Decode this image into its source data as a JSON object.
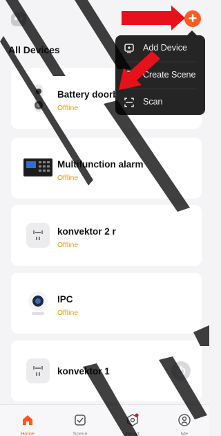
{
  "header": {
    "title": "All Devices",
    "add_label": "+"
  },
  "menu": {
    "items": [
      {
        "label": "Add Device",
        "icon": "add-device-icon"
      },
      {
        "label": "Create Scene",
        "icon": "create-scene-icon"
      },
      {
        "label": "Scan",
        "icon": "scan-icon"
      }
    ]
  },
  "devices": [
    {
      "name": "Battery doorbell",
      "status": "Offline",
      "icon": "doorbell-icon"
    },
    {
      "name": "Multifunction alarm",
      "status": "Offline",
      "icon": "alarm-panel-icon"
    },
    {
      "name": "konvektor 2 r",
      "status": "Offline",
      "icon": "heater-icon"
    },
    {
      "name": "IPC",
      "status": "Offline",
      "icon": "camera-icon"
    },
    {
      "name": "konvektor 1",
      "status": "",
      "icon": "heater-icon",
      "power": "off"
    }
  ],
  "tabs": [
    {
      "label": "Home",
      "icon": "home-tab-icon",
      "active": true
    },
    {
      "label": "Scene",
      "icon": "scene-tab-icon"
    },
    {
      "label": "Smart",
      "icon": "smart-tab-icon"
    },
    {
      "label": "Me",
      "icon": "me-tab-icon"
    }
  ],
  "colors": {
    "accent": "#ff5a1f",
    "status_offline": "#f59a00",
    "menu_bg": "#252525",
    "annotation_arrow": "#e8101a"
  }
}
